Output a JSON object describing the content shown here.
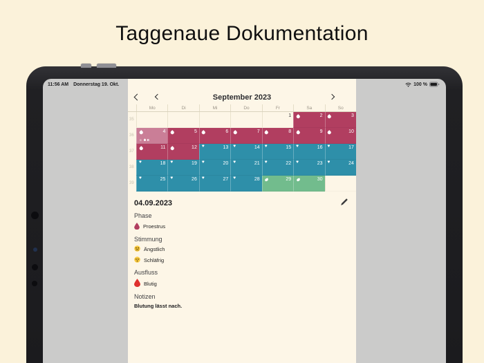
{
  "page": {
    "title": "Taggenaue Dokumentation"
  },
  "statusbar": {
    "time": "11:56 AM",
    "date": "Donnerstag 19. Okt.",
    "wifi_icon": "wifi-icon",
    "battery_level": "100 %",
    "battery_icon": "battery-full-icon"
  },
  "colors": {
    "proestrus": "#b13e60",
    "proestrus-selected": "#ca7e97",
    "estrus": "#2e8fa9",
    "anestrus": "#72bc8d",
    "panel": "#fdf6e7",
    "page_background": "#fbf2da"
  },
  "calendar": {
    "back_icon": "chevron-left",
    "prev_icon": "chevron-left",
    "next_icon": "chevron-right",
    "month_title": "September 2023",
    "day_headers": [
      "Mo",
      "Di",
      "Mi",
      "Do",
      "Fr",
      "Sa",
      "So"
    ],
    "weeks": [
      {
        "number": "35",
        "days": [
          {
            "day": "",
            "phase": "none"
          },
          {
            "day": "",
            "phase": "none"
          },
          {
            "day": "",
            "phase": "none"
          },
          {
            "day": "",
            "phase": "none"
          },
          {
            "day": "1",
            "phase": "none"
          },
          {
            "day": "2",
            "phase": "proestrus",
            "icon": "drop"
          },
          {
            "day": "3",
            "phase": "proestrus",
            "icon": "drop"
          }
        ]
      },
      {
        "number": "36",
        "days": [
          {
            "day": "4",
            "phase": "proestrus-selected",
            "icon": "drop",
            "extras": [
              "mood-icon",
              "discharge-icon",
              "note-icon"
            ]
          },
          {
            "day": "5",
            "phase": "proestrus",
            "icon": "drop"
          },
          {
            "day": "6",
            "phase": "proestrus",
            "icon": "drop"
          },
          {
            "day": "7",
            "phase": "proestrus",
            "icon": "drop"
          },
          {
            "day": "8",
            "phase": "proestrus",
            "icon": "drop"
          },
          {
            "day": "9",
            "phase": "proestrus",
            "icon": "drop"
          },
          {
            "day": "10",
            "phase": "proestrus",
            "icon": "drop"
          }
        ]
      },
      {
        "number": "37",
        "days": [
          {
            "day": "11",
            "phase": "proestrus",
            "icon": "drop"
          },
          {
            "day": "12",
            "phase": "proestrus",
            "icon": "drop"
          },
          {
            "day": "13",
            "phase": "estrus",
            "icon": "heart"
          },
          {
            "day": "14",
            "phase": "estrus",
            "icon": "heart"
          },
          {
            "day": "15",
            "phase": "estrus",
            "icon": "heart"
          },
          {
            "day": "16",
            "phase": "estrus",
            "icon": "heart"
          },
          {
            "day": "17",
            "phase": "estrus",
            "icon": "heart"
          }
        ]
      },
      {
        "number": "38",
        "days": [
          {
            "day": "18",
            "phase": "estrus",
            "icon": "heart"
          },
          {
            "day": "19",
            "phase": "estrus",
            "icon": "heart"
          },
          {
            "day": "20",
            "phase": "estrus",
            "icon": "heart"
          },
          {
            "day": "21",
            "phase": "estrus",
            "icon": "heart"
          },
          {
            "day": "22",
            "phase": "estrus",
            "icon": "heart"
          },
          {
            "day": "23",
            "phase": "estrus",
            "icon": "heart"
          },
          {
            "day": "24",
            "phase": "estrus",
            "icon": "heart"
          }
        ]
      },
      {
        "number": "39",
        "days": [
          {
            "day": "25",
            "phase": "estrus",
            "icon": "heart"
          },
          {
            "day": "26",
            "phase": "estrus",
            "icon": "heart"
          },
          {
            "day": "27",
            "phase": "estrus",
            "icon": "heart"
          },
          {
            "day": "28",
            "phase": "estrus",
            "icon": "heart"
          },
          {
            "day": "29",
            "phase": "anestrus",
            "icon": "leaf"
          },
          {
            "day": "30",
            "phase": "anestrus",
            "icon": "leaf"
          },
          {
            "day": "",
            "phase": "none"
          }
        ]
      }
    ]
  },
  "detail": {
    "date": "04.09.2023",
    "edit_icon": "pencil-icon",
    "sections": [
      {
        "label": "Phase",
        "items": [
          {
            "icon": "proestrus-drop",
            "text": "Proestrus"
          }
        ]
      },
      {
        "label": "Stimmung",
        "items": [
          {
            "icon": "anxious-emoji",
            "text": "Ängstlich"
          },
          {
            "icon": "sleepy-emoji",
            "text": "Schläfrig"
          }
        ]
      },
      {
        "label": "Ausfluss",
        "items": [
          {
            "icon": "blood-drop",
            "text": "Blutig"
          }
        ]
      },
      {
        "label": "Notizen",
        "note": "Blutung lässt nach."
      }
    ]
  }
}
